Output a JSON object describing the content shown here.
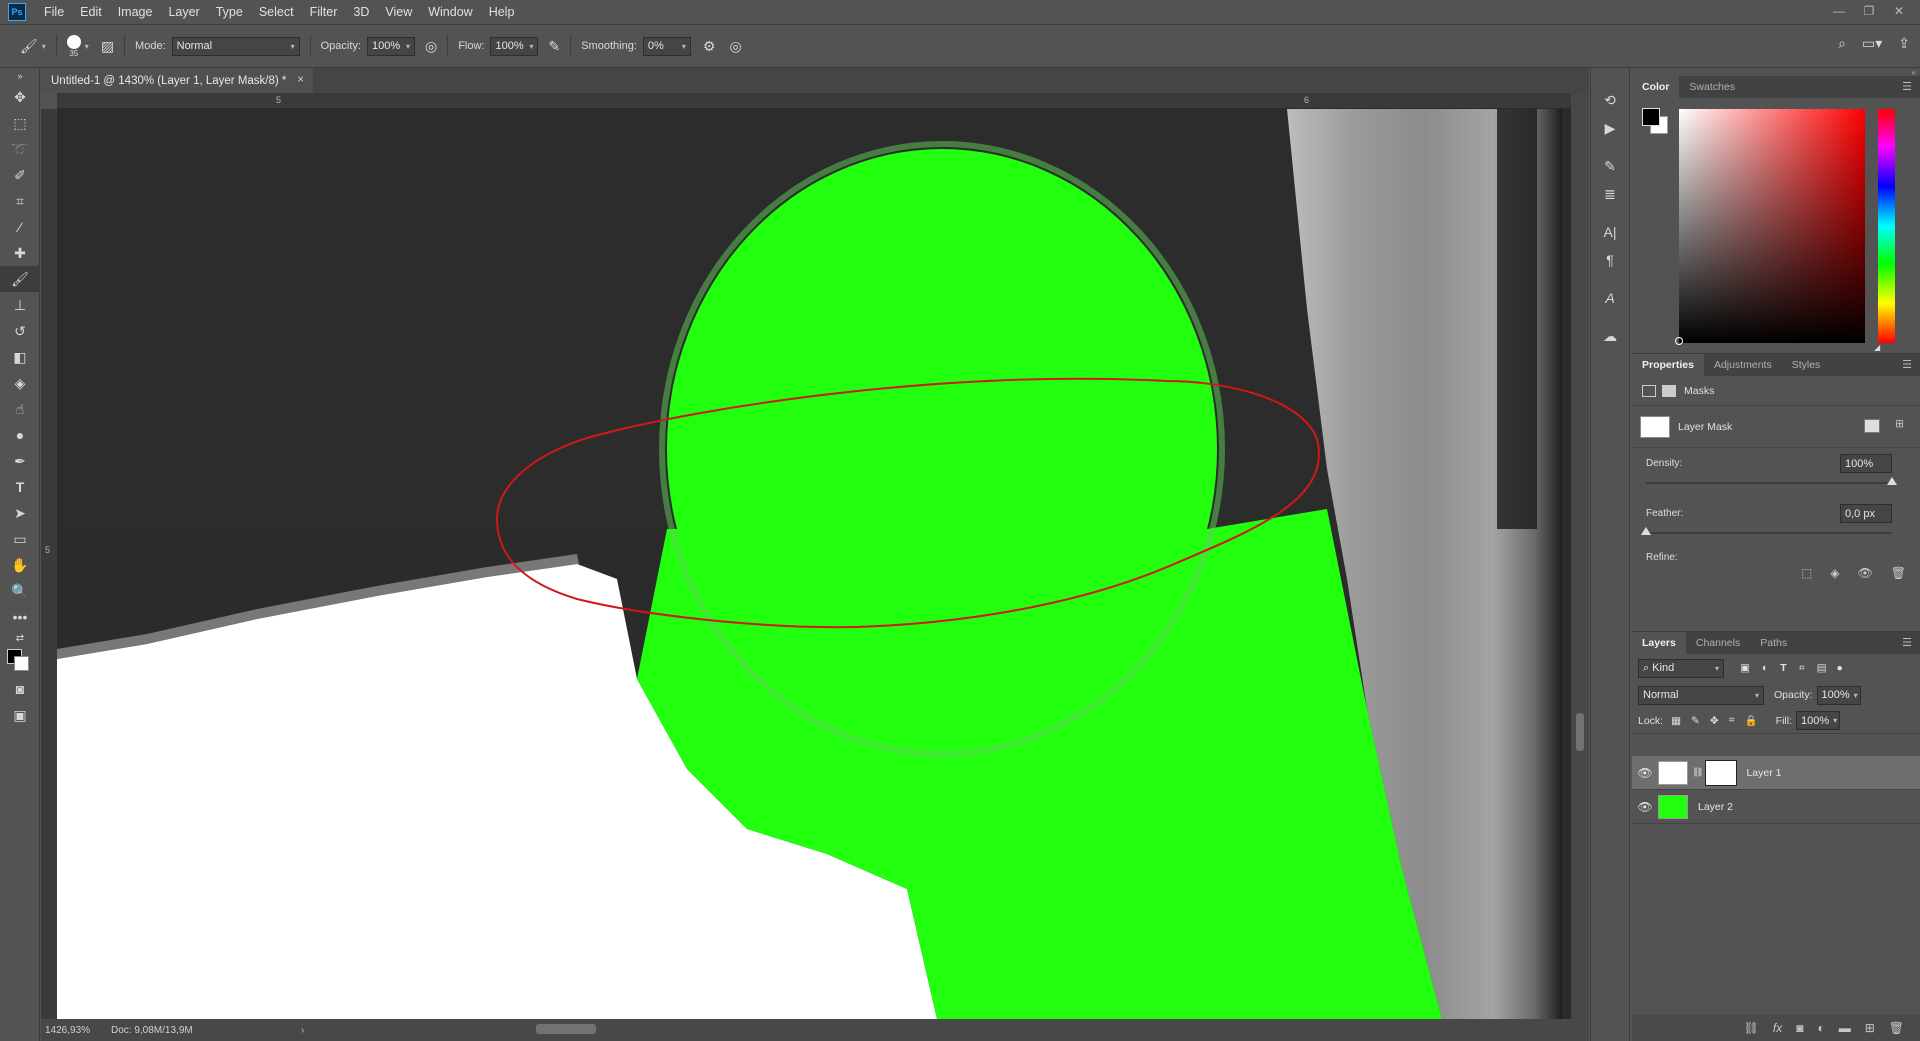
{
  "menu": {
    "logo": "Ps",
    "items": [
      "File",
      "Edit",
      "Image",
      "Layer",
      "Type",
      "Select",
      "Filter",
      "3D",
      "View",
      "Window",
      "Help"
    ],
    "window_controls": [
      "minimize-icon",
      "restore-icon",
      "close-icon"
    ]
  },
  "options": {
    "brush_size": "35",
    "mode_label": "Mode:",
    "mode_value": "Normal",
    "opacity_label": "Opacity:",
    "opacity_value": "100%",
    "flow_label": "Flow:",
    "flow_value": "100%",
    "smoothing_label": "Smoothing:",
    "smoothing_value": "0%"
  },
  "document": {
    "tab_title": "Untitled-1 @ 1430% (Layer 1, Layer Mask/8) *",
    "close_glyph": "×",
    "ruler_h_labels": [
      "5",
      "6"
    ],
    "ruler_v_labels": [
      "5"
    ]
  },
  "status": {
    "zoom": "1426,93%",
    "doc": "Doc: 9,08M/13,9M"
  },
  "colors": {
    "green": "#22ff0e",
    "dark_bg": "#2b2b2b",
    "white_area": "#ffffff",
    "annotation_red": "#d01818",
    "foreground": "#000000",
    "background": "#ffffff"
  },
  "panels": {
    "color_tabs": [
      "Color",
      "Swatches"
    ],
    "properties_tabs": [
      "Properties",
      "Adjustments",
      "Styles"
    ],
    "masks_title": "Masks",
    "layer_mask_label": "Layer Mask",
    "density_label": "Density:",
    "density_value": "100%",
    "density_level": 1.0,
    "feather_label": "Feather:",
    "feather_value": "0,0 px",
    "feather_level": 0.0,
    "refine_label": "Refine:",
    "layers_tabs": [
      "Layers",
      "Channels",
      "Paths"
    ],
    "kind_label": "Kind",
    "blend_mode": "Normal",
    "opacity_label": "Opacity:",
    "opacity_value": "100%",
    "lock_label": "Lock:",
    "fill_label": "Fill:",
    "fill_value": "100%"
  },
  "layers": [
    {
      "name": "Layer 1",
      "selected": true,
      "has_mask": true
    },
    {
      "name": "Layer 2",
      "selected": false,
      "has_mask": false
    }
  ]
}
